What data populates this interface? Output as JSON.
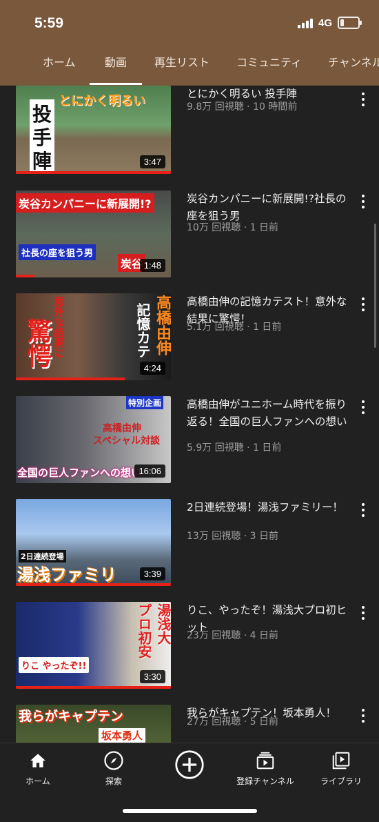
{
  "status": {
    "time": "5:59",
    "network": "4G"
  },
  "tabs": [
    {
      "label": "ホーム"
    },
    {
      "label": "動画",
      "active": true
    },
    {
      "label": "再生リスト"
    },
    {
      "label": "コミュニティ"
    },
    {
      "label": "チャンネル"
    }
  ],
  "videos": [
    {
      "title": "とにかく明るい 投手陣",
      "meta": "9.8万 回視聴 · 10 時間前",
      "duration": "3:47",
      "thumb_texts": [
        "とにかく明るい",
        "投",
        "手",
        "陣"
      ]
    },
    {
      "title": "炭谷カンパニーに新展開!?社長の座を狙う男",
      "meta": "10万 回視聴 · 1 日前",
      "duration": "1:48",
      "thumb_texts": [
        "炭谷カンパニーに新展開!?",
        "社長の座を狙う男",
        "炭谷"
      ]
    },
    {
      "title": "高橋由伸の記憶カテスト！意外な結果に驚愕！",
      "meta": "5.1万 回視聴 · 1 日前",
      "duration": "4:24",
      "thumb_texts": [
        "意外な結果に",
        "驚愕",
        "高橋由伸",
        "記憶カテ"
      ]
    },
    {
      "title": "高橋由伸がユニホーム時代を振り返る！全国の巨人ファンへの想い",
      "meta": "5.9万 回視聴 · 1 日前",
      "duration": "16:06",
      "thumb_texts": [
        "特別企画",
        "高橋由伸",
        "スペシャル対談",
        "全国の巨人ファンへの想い"
      ]
    },
    {
      "title": "2日連続登場！湯浅ファミリー！",
      "meta": "13万 回視聴 · 3 日前",
      "duration": "3:39",
      "thumb_texts": [
        "2日連続登場",
        "湯浅ファミリ"
      ]
    },
    {
      "title": "りこ、やったぞ！湯浅大プロ初ヒット",
      "meta": "23万 回視聴 · 4 日前",
      "duration": "3:30",
      "thumb_texts": [
        "湯浅大",
        "プロ初安",
        "りこ やったぞ!!"
      ]
    },
    {
      "title": "我らがキャプテン！坂本勇人！",
      "meta": "27万 回視聴 · 5 日前",
      "duration": "",
      "thumb_texts": [
        "我らがキャプテン",
        "坂本勇人"
      ]
    }
  ],
  "nav": [
    {
      "label": "ホーム",
      "icon": "home-icon"
    },
    {
      "label": "探索",
      "icon": "compass-icon"
    },
    {
      "label": "",
      "icon": "add-icon"
    },
    {
      "label": "登録チャンネル",
      "icon": "subscriptions-icon"
    },
    {
      "label": "ライブラリ",
      "icon": "library-icon"
    }
  ],
  "colors": {
    "header": "#79583c",
    "background": "#212121",
    "progress": "#e62117"
  }
}
